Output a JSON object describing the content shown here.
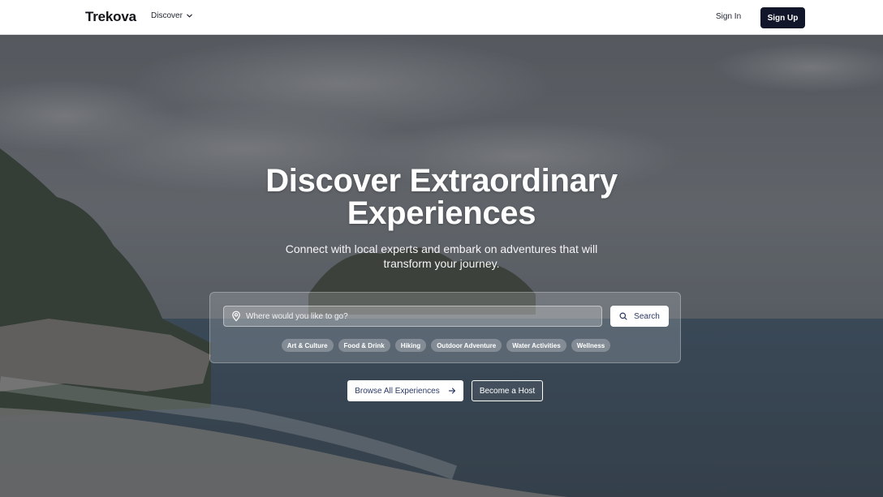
{
  "nav": {
    "logo": "Trekova",
    "discover_label": "Discover",
    "sign_in_label": "Sign In",
    "sign_up_label": "Sign Up"
  },
  "hero": {
    "title_line1": "Discover Extraordinary",
    "title_line2": "Experiences",
    "subtitle": "Connect with local experts and embark on adventures that will transform your journey.",
    "search": {
      "placeholder": "Where would you like to go?",
      "value": "",
      "button_label": "Search"
    },
    "tags": [
      "Art & Culture",
      "Food & Drink",
      "Hiking",
      "Outdoor Adventure",
      "Water Activities",
      "Wellness"
    ],
    "browse_label": "Browse All Experiences",
    "host_label": "Become a Host"
  },
  "icons": {
    "discover": "chevron-down-icon",
    "location": "map-pin-icon",
    "search": "search-icon",
    "browse": "arrow-right-icon"
  },
  "colors": {
    "primary_dark": "#11162a",
    "accent_text": "#2c3a66"
  }
}
